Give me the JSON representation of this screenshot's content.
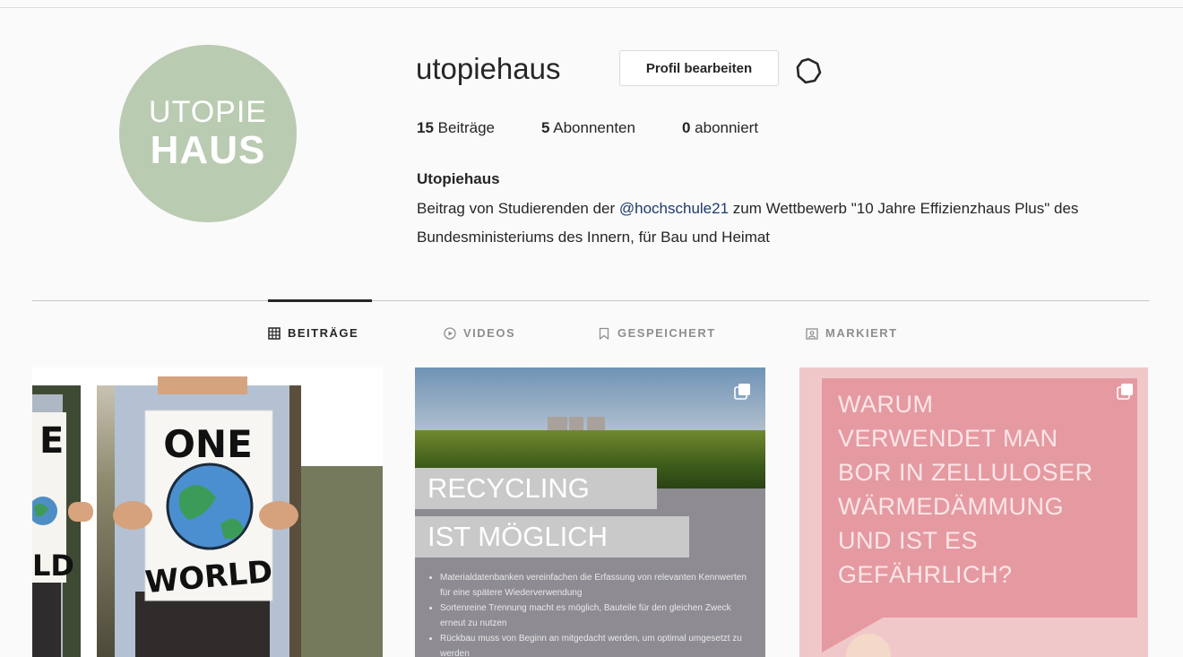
{
  "profile": {
    "avatar_line1": "UTOPIE",
    "avatar_line2": "HAUS",
    "username": "utopiehaus",
    "edit_label": "Profil bearbeiten",
    "stats": [
      {
        "count": "15",
        "label": "Beiträge"
      },
      {
        "count": "5",
        "label": "Abonnenten"
      },
      {
        "count": "0",
        "label": "abonniert"
      }
    ],
    "display_name": "Utopiehaus",
    "bio_before": "Beitrag von Studierenden der ",
    "bio_mention": "@hochschule21",
    "bio_after": " zum Wettbewerb \"10 Jahre Effizienzhaus Plus\" des Bundesministeriums des Innern, für Bau und Heimat"
  },
  "tabs": [
    {
      "label": "BEITRÄGE",
      "icon": "grid-icon",
      "active": true
    },
    {
      "label": "VIDEOS",
      "icon": "video-icon",
      "active": false
    },
    {
      "label": "GESPEICHERT",
      "icon": "bookmark-icon",
      "active": false
    },
    {
      "label": "MARKIERT",
      "icon": "tagged-icon",
      "active": false
    }
  ],
  "posts": [
    {
      "sign_text_top": "ONE",
      "sign_text_bottom": "WORLD",
      "sign_left_top": "E",
      "sign_left_bottom": "LD"
    },
    {
      "banner1": "RECYCLING",
      "banner2": "IST MÖGLICH",
      "bullets": [
        "Materialdatenbanken vereinfachen die Erfassung von rele­vanten Kennwerten für eine spätere Wiederverwendung",
        "Sortenreine Trennung macht es möglich, Bauteile für den gleichen Zweck erneut zu nutzen",
        "Rückbau muss von Beginn an mitgedacht werden, um optimal umgesetzt zu werden"
      ]
    },
    {
      "text_lines": [
        "WARUM",
        "VERWENDET MAN",
        "BOR IN ZELLULOSER",
        "WÄRMEDÄMMUNG",
        "UND IST ES",
        "GEFÄHRLICH?"
      ]
    }
  ],
  "colors": {
    "avatar_bg": "#b9cbb1",
    "mention": "#1e3a6e",
    "post3_bg": "#f0c8ca",
    "post3_box": "#e59aa1"
  }
}
